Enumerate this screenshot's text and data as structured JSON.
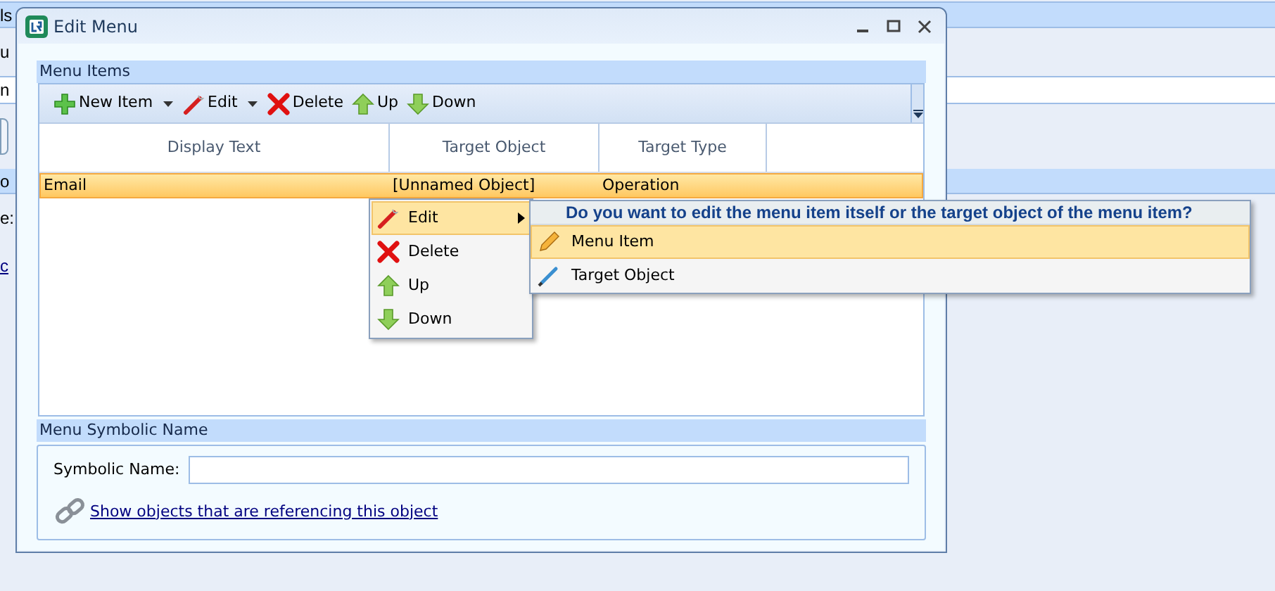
{
  "background": {
    "rows": [
      {
        "kind": "header",
        "text": "ls"
      },
      {
        "kind": "label",
        "text": "u"
      },
      {
        "kind": "field",
        "text": "n"
      },
      {
        "kind": "button"
      },
      {
        "kind": "header",
        "text": "o"
      },
      {
        "kind": "label",
        "text": "e:"
      },
      {
        "kind": "link",
        "text": "c"
      }
    ]
  },
  "window": {
    "title": "Edit Menu"
  },
  "menu_items": {
    "title": "Menu Items",
    "toolbar": [
      {
        "label": "New Item",
        "kind": "add",
        "dropdown": true
      },
      {
        "label": "Edit",
        "kind": "edit",
        "dropdown": true
      },
      {
        "label": "Delete",
        "kind": "delete",
        "dropdown": false
      },
      {
        "label": "Up",
        "kind": "up",
        "dropdown": false
      },
      {
        "label": "Down",
        "kind": "down",
        "dropdown": false
      }
    ],
    "columns": [
      "Display Text",
      "Target Object",
      "Target Type"
    ],
    "rows": [
      {
        "cells": [
          "Email",
          "[Unnamed Object]",
          "Operation"
        ],
        "selected": true
      }
    ]
  },
  "context_menu": {
    "items": [
      {
        "label": "Edit",
        "kind": "edit",
        "selected": true,
        "submenu": true
      },
      {
        "label": "Delete",
        "kind": "delete",
        "selected": false,
        "submenu": false
      },
      {
        "label": "Up",
        "kind": "up",
        "selected": false,
        "submenu": false
      },
      {
        "label": "Down",
        "kind": "down",
        "selected": false,
        "submenu": false
      }
    ]
  },
  "submenu": {
    "prompt": "Do you want to edit the menu item itself or the target object of the menu item?",
    "items": [
      {
        "label": "Menu Item",
        "kind": "pencil",
        "selected": true
      },
      {
        "label": "Target Object",
        "kind": "brush",
        "selected": false
      }
    ]
  },
  "symbolic": {
    "title": "Menu Symbolic Name",
    "label": "Symbolic Name:",
    "link": "Show objects that are referencing this object"
  }
}
